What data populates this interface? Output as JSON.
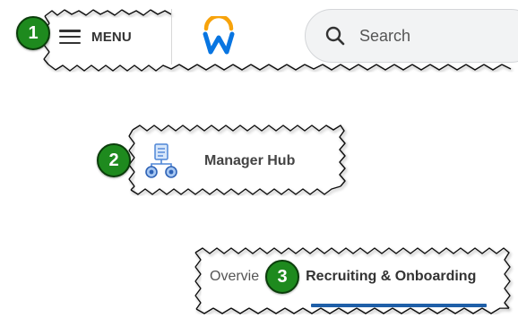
{
  "header": {
    "menu_label": "MENU",
    "menu_icon": "hamburger-icon",
    "logo_icon": "workday-logo-icon",
    "search_placeholder": "Search",
    "search_icon": "search-icon"
  },
  "manager_hub": {
    "label": "Manager Hub",
    "icon": "manager-hub-app-icon"
  },
  "tabs": {
    "items": [
      {
        "label": "Overvie",
        "active": false
      },
      {
        "label": "Recruiting & Onboarding",
        "active": true
      }
    ]
  },
  "steps": [
    "1",
    "2",
    "3"
  ],
  "colors": {
    "badge_green": "#1e8a1e",
    "logo_blue": "#0875e1",
    "logo_orange": "#f7a30c",
    "tab_underline": "#1f5fa8",
    "hub_icon_blue": "#6a9ee0"
  }
}
